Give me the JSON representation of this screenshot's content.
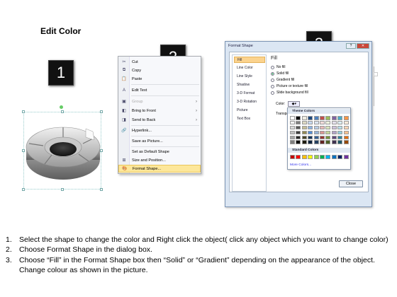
{
  "title": "Edit Color",
  "badges": [
    "1",
    "2",
    "3"
  ],
  "context_menu": {
    "items": [
      {
        "icon": "cut-icon",
        "glyph": "✂",
        "label": "Cut",
        "disabled": false,
        "submenu": false
      },
      {
        "icon": "copy-icon",
        "glyph": "⧉",
        "label": "Copy",
        "disabled": false,
        "submenu": false
      },
      {
        "icon": "paste-icon",
        "glyph": "📋",
        "label": "Paste",
        "disabled": false,
        "submenu": false
      },
      {
        "icon": "edit-text-icon",
        "glyph": "A",
        "label": "Edit Text",
        "disabled": false,
        "submenu": false
      },
      {
        "icon": "group-icon",
        "glyph": "▣",
        "label": "Group",
        "disabled": true,
        "submenu": true
      },
      {
        "icon": "bring-to-front-icon",
        "glyph": "◧",
        "label": "Bring to Front",
        "disabled": false,
        "submenu": true
      },
      {
        "icon": "send-to-back-icon",
        "glyph": "◨",
        "label": "Send to Back",
        "disabled": false,
        "submenu": true
      },
      {
        "icon": "hyperlink-icon",
        "glyph": "🔗",
        "label": "Hyperlink...",
        "disabled": false,
        "submenu": false
      },
      {
        "icon": "save-as-picture-icon",
        "glyph": "",
        "label": "Save as Picture...",
        "disabled": false,
        "submenu": false
      },
      {
        "icon": "set-default-shape-icon",
        "glyph": "",
        "label": "Set as Default Shape",
        "disabled": false,
        "submenu": false
      },
      {
        "icon": "size-position-icon",
        "glyph": "⊞",
        "label": "Size and Position...",
        "disabled": false,
        "submenu": false
      },
      {
        "icon": "format-shape-icon",
        "glyph": "🎨",
        "label": "Format Shape...",
        "disabled": false,
        "submenu": false,
        "highlighted": true
      }
    ]
  },
  "dialog": {
    "title": "Format Shape",
    "nav": [
      "Fill",
      "Line Color",
      "Line Style",
      "Shadow",
      "3-D Format",
      "3-D Rotation",
      "Picture",
      "Text Box"
    ],
    "active_nav": "Fill",
    "heading": "Fill",
    "options": [
      "No fill",
      "Solid fill",
      "Gradient fill",
      "Picture or texture fill",
      "Slide background fill"
    ],
    "selected_option": "Solid fill",
    "color_label": "Color:",
    "transparency_label": "Transpa",
    "close_label": "Close",
    "palette": {
      "theme_label": "Theme Colors",
      "standard_label": "Standard Colors",
      "more_label": "More Colors...",
      "theme_colors": [
        [
          "#ffffff",
          "#000000",
          "#eeece1",
          "#1f497d",
          "#4f81bd",
          "#c0504d",
          "#9bbb59",
          "#8064a2",
          "#4bacc6",
          "#f79646"
        ],
        [
          "#f2f2f2",
          "#7f7f7f",
          "#ddd9c3",
          "#c6d9f0",
          "#dbe5f1",
          "#f2dcdb",
          "#ebf1dd",
          "#e5e0ec",
          "#dbeef3",
          "#fdeada"
        ],
        [
          "#d8d8d8",
          "#595959",
          "#c4bd97",
          "#8db3e2",
          "#b8cce4",
          "#e5b9b7",
          "#d7e3bc",
          "#ccc1d9",
          "#b7dde8",
          "#fbd5b5"
        ],
        [
          "#bfbfbf",
          "#3f3f3f",
          "#938953",
          "#548dd4",
          "#95b3d7",
          "#d99694",
          "#c3d69b",
          "#b2a2c7",
          "#92cddc",
          "#fac08f"
        ],
        [
          "#a5a5a5",
          "#262626",
          "#494429",
          "#17365d",
          "#366092",
          "#953734",
          "#76923c",
          "#5f497a",
          "#31859b",
          "#e36c09"
        ],
        [
          "#7f7f7f",
          "#0c0c0c",
          "#1d1b10",
          "#0f243e",
          "#244061",
          "#632423",
          "#4f6128",
          "#3f3151",
          "#205867",
          "#974806"
        ]
      ],
      "standard_colors": [
        "#c00000",
        "#ff0000",
        "#ffc000",
        "#ffff00",
        "#92d050",
        "#00b050",
        "#00b0f0",
        "#0070c0",
        "#002060",
        "#7030a0"
      ]
    }
  },
  "instructions": [
    {
      "num": "1.",
      "text": "Select the shape to change the color and Right click the object( click any object which you want to change color)"
    },
    {
      "num": "2.",
      "text": "Choose Format Shape in the dialog box."
    },
    {
      "num": "3.",
      "text": "Choose “Fill” in the Format Shape box then “Solid” or “Gradient” depending on the appearance of the object. Change colour as shown in the picture."
    }
  ],
  "colors": {
    "badge_bg": "#111111",
    "menu_highlight": "#fde79a",
    "dialog_frame": "#dbe6f3"
  }
}
